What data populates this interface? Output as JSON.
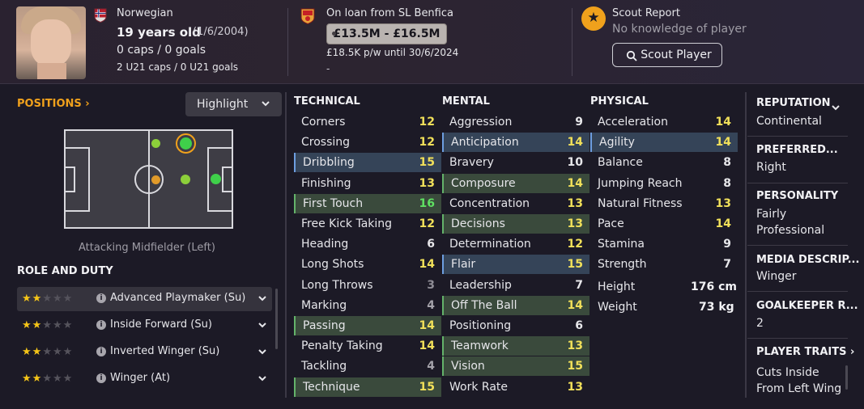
{
  "header": {
    "nationality": "Norwegian",
    "age_text": "19 years old",
    "dob": "(1/6/2004)",
    "caps": "0 caps / 0 goals",
    "u21": "2 U21 caps / 0 U21 goals",
    "loan_text": "On loan from SL Benfica",
    "value_range": "£13.5M - £16.5M",
    "wage_text": "£18.5K p/w until 30/6/2024",
    "dash": "-",
    "scout_title": "Scout Report",
    "scout_status": "No knowledge of player",
    "scout_button": "Scout Player"
  },
  "positions": {
    "label": "POSITIONS",
    "highlight_label": "Highlight",
    "caption": "Attacking Midfielder (Left)"
  },
  "roles": {
    "title": "ROLE AND DUTY",
    "items": [
      {
        "name": "Advanced Playmaker (Su)",
        "stars": 2
      },
      {
        "name": "Inside Forward (Su)",
        "stars": 2
      },
      {
        "name": "Inverted Winger (Su)",
        "stars": 2
      },
      {
        "name": "Winger (At)",
        "stars": 2
      }
    ]
  },
  "technical": {
    "title": "TECHNICAL",
    "items": [
      {
        "name": "Corners",
        "value": "12"
      },
      {
        "name": "Crossing",
        "value": "12"
      },
      {
        "name": "Dribbling",
        "value": "15",
        "hl": "b"
      },
      {
        "name": "Finishing",
        "value": "13"
      },
      {
        "name": "First Touch",
        "value": "16",
        "hl": "g"
      },
      {
        "name": "Free Kick Taking",
        "value": "12"
      },
      {
        "name": "Heading",
        "value": "6"
      },
      {
        "name": "Long Shots",
        "value": "14"
      },
      {
        "name": "Long Throws",
        "value": "3"
      },
      {
        "name": "Marking",
        "value": "4"
      },
      {
        "name": "Passing",
        "value": "14",
        "hl": "g"
      },
      {
        "name": "Penalty Taking",
        "value": "14"
      },
      {
        "name": "Tackling",
        "value": "4"
      },
      {
        "name": "Technique",
        "value": "15",
        "hl": "g"
      }
    ]
  },
  "mental": {
    "title": "MENTAL",
    "items": [
      {
        "name": "Aggression",
        "value": "9"
      },
      {
        "name": "Anticipation",
        "value": "14",
        "hl": "b"
      },
      {
        "name": "Bravery",
        "value": "10"
      },
      {
        "name": "Composure",
        "value": "14",
        "hl": "g"
      },
      {
        "name": "Concentration",
        "value": "13"
      },
      {
        "name": "Decisions",
        "value": "13",
        "hl": "g"
      },
      {
        "name": "Determination",
        "value": "12"
      },
      {
        "name": "Flair",
        "value": "15",
        "hl": "b"
      },
      {
        "name": "Leadership",
        "value": "7"
      },
      {
        "name": "Off The Ball",
        "value": "14",
        "hl": "g"
      },
      {
        "name": "Positioning",
        "value": "6"
      },
      {
        "name": "Teamwork",
        "value": "13",
        "hl": "g"
      },
      {
        "name": "Vision",
        "value": "15",
        "hl": "g"
      },
      {
        "name": "Work Rate",
        "value": "13"
      }
    ]
  },
  "physical": {
    "title": "PHYSICAL",
    "items": [
      {
        "name": "Acceleration",
        "value": "14"
      },
      {
        "name": "Agility",
        "value": "14",
        "hl": "b"
      },
      {
        "name": "Balance",
        "value": "8"
      },
      {
        "name": "Jumping Reach",
        "value": "8"
      },
      {
        "name": "Natural Fitness",
        "value": "13"
      },
      {
        "name": "Pace",
        "value": "14"
      },
      {
        "name": "Stamina",
        "value": "9"
      },
      {
        "name": "Strength",
        "value": "7"
      }
    ],
    "height_label": "Height",
    "height_value": "176 cm",
    "weight_label": "Weight",
    "weight_value": "73 kg"
  },
  "side": {
    "reputation_label": "REPUTATION",
    "reputation_value": "Continental",
    "preferred_label": "PREFERRED...",
    "preferred_value": "Right",
    "personality_label": "PERSONALITY",
    "personality_line1": "Fairly",
    "personality_line2": "Professional",
    "media_label": "MEDIA DESCRIP...",
    "media_value": "Winger",
    "gk_label": "GOALKEEPER R...",
    "gk_value": "2",
    "traits_label": "PLAYER TRAITS",
    "traits_line1": "Cuts Inside",
    "traits_line2": "From Left Wing"
  },
  "colors": {
    "accent": "#f0a11c",
    "good": "#5fe062",
    "high": "#f1e05a"
  }
}
